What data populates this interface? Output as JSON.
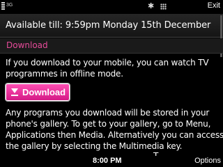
{
  "status": {
    "network": "3G",
    "exit_label": "Exit"
  },
  "availability": "Available till: 9:59pm Monday 15th December",
  "section_title": "Download",
  "intro_lines": [
    "If you download to your mobile, you can watch TV",
    "programmes in offline mode."
  ],
  "download_button_label": "Download",
  "info_lines": [
    "Any programs you download will be stored in your",
    "phone's gallery. To get to your gallery, go to Menu,",
    "Applications then Media. Alternatively you can access",
    "the gallery by selecting the Multimedia key."
  ],
  "clipped_text": "T",
  "softkeys": {
    "time": "8:00 PM",
    "options_label": "Options"
  },
  "colors": {
    "accent_pink": "#e74b9a",
    "button_pink": "#d41a86"
  }
}
